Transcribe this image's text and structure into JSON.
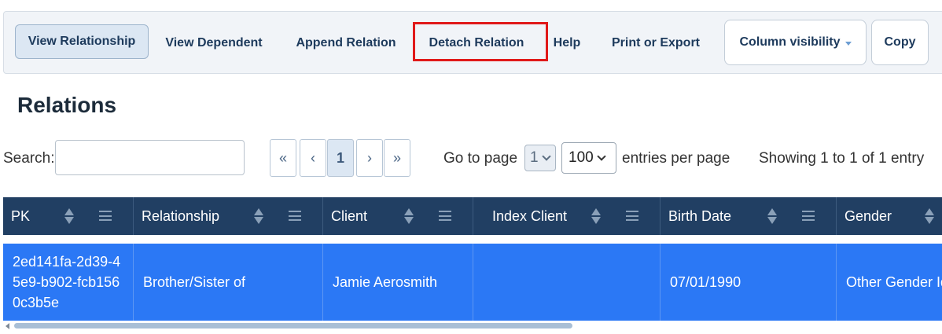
{
  "toolbar": {
    "buttons": [
      {
        "label": "View Relationship"
      },
      {
        "label": "View Dependent"
      },
      {
        "label": "Append Relation"
      },
      {
        "label": "Detach Relation"
      },
      {
        "label": "Help"
      },
      {
        "label": "Print or Export"
      },
      {
        "label": "Column visibility"
      },
      {
        "label": "Copy"
      }
    ]
  },
  "page_title": "Relations",
  "search": {
    "label": "Search:",
    "value": "",
    "placeholder": ""
  },
  "pagination": {
    "first": "«",
    "prev": "‹",
    "current": "1",
    "next": "›",
    "last": "»",
    "goto_label": "Go to page",
    "goto_value": "1",
    "per_page_value": "100",
    "per_page_label": "entries per page",
    "info": "Showing 1 to 1 of 1 entry"
  },
  "table": {
    "columns": [
      "PK",
      "Relationship",
      "Client",
      "Index Client",
      "Birth Date",
      "Gender"
    ],
    "rows": [
      {
        "pk": "2ed141fa-2d39-45e9-b902-fcb1560c3b5e",
        "relationship": "Brother/Sister of",
        "client": "Jamie Aerosmith",
        "index_client": "",
        "birth_date": "07/01/1990",
        "gender": "Other Gender Identity"
      }
    ]
  },
  "colors": {
    "header_bg": "#213f63",
    "selected_row_bg": "#2b78f5",
    "highlight_border": "#e01919",
    "toolbar_bg": "#f1f4f8"
  }
}
